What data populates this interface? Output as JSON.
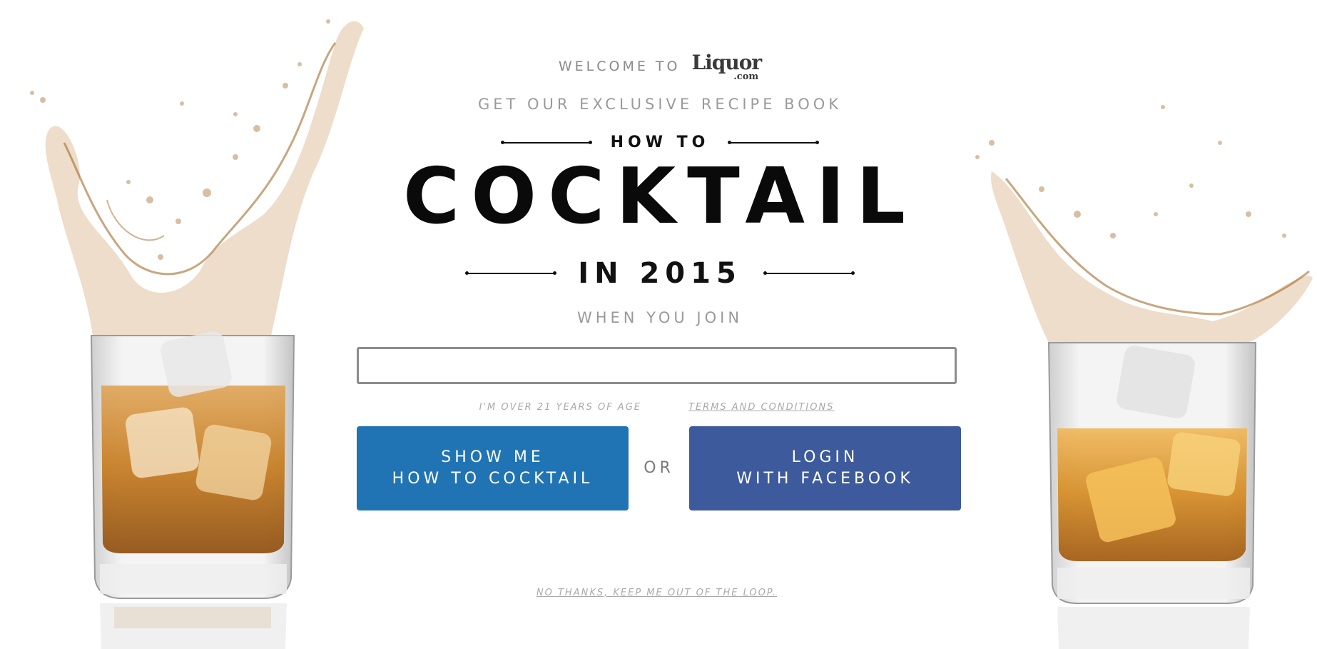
{
  "header": {
    "welcome_text": "WELCOME TO",
    "logo_main": "Liquor",
    "logo_sub": ".com"
  },
  "promo": {
    "subhead": "GET OUR EXCLUSIVE RECIPE BOOK",
    "how_to": "HOW TO",
    "title": "COCKTAIL",
    "year_line": "IN 2015",
    "join_text": "WHEN YOU JOIN"
  },
  "form": {
    "email_value": "",
    "email_placeholder": "",
    "age_text": "I'M OVER 21 YEARS OF AGE",
    "terms_link": "TERMS AND CONDITIONS",
    "show_button_line1": "SHOW ME",
    "show_button_line2": "HOW TO COCKTAIL",
    "or_text": "OR",
    "fb_button_line1": "LOGIN",
    "fb_button_line2": "WITH FACEBOOK",
    "no_thanks": "NO THANKS, KEEP ME OUT OF THE LOOP."
  },
  "colors": {
    "show_button": "#2174b4",
    "facebook_button": "#3d5a9d",
    "whiskey": "#c47a1e",
    "muted_text": "#9a9a9a"
  },
  "icons": {
    "left_image": "whiskey-glass-splash-illustration",
    "right_image": "whiskey-glass-splash-illustration"
  }
}
